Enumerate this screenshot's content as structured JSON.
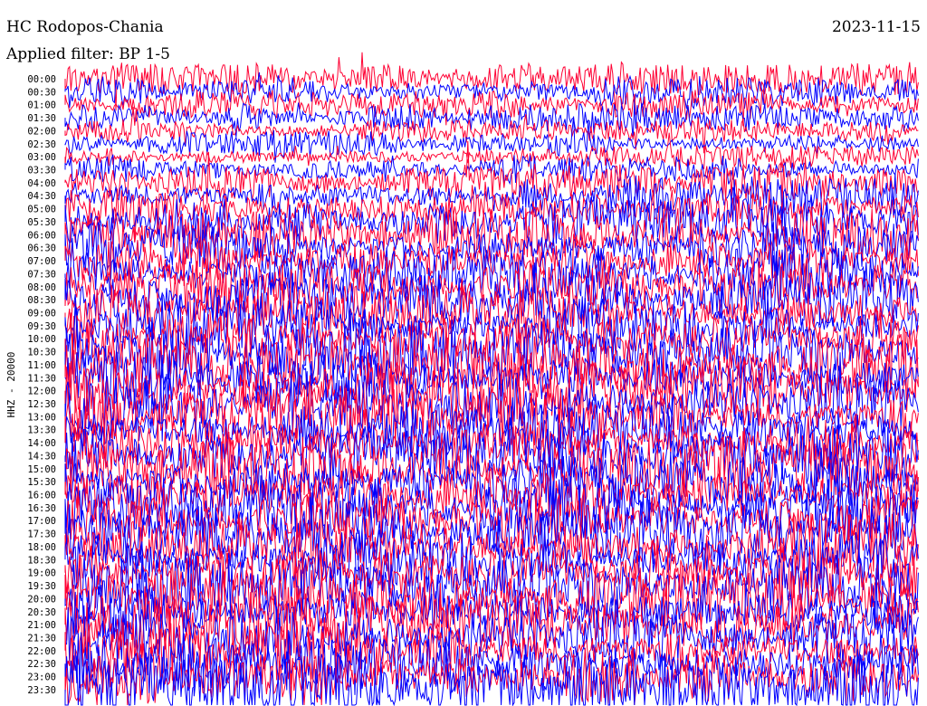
{
  "header": {
    "station": "HC Rodopos-Chania",
    "date": "2023-11-15",
    "filter": "Applied filter: BP 1-5"
  },
  "chart_data": {
    "type": "helicorder",
    "channel_label": "HHZ - 20000",
    "ylabel": "HHZ - 20000",
    "tick_labels": [
      "00:00",
      "00:30",
      "01:00",
      "01:30",
      "02:00",
      "02:30",
      "03:00",
      "03:30",
      "04:00",
      "04:30",
      "05:00",
      "05:30",
      "06:00",
      "06:30",
      "07:00",
      "07:30",
      "08:00",
      "08:30",
      "09:00",
      "09:30",
      "10:00",
      "10:30",
      "11:00",
      "11:30",
      "12:00",
      "12:30",
      "13:00",
      "13:30",
      "14:00",
      "14:30",
      "15:00",
      "15:30",
      "16:00",
      "16:30",
      "17:00",
      "17:30",
      "18:00",
      "18:30",
      "19:00",
      "19:30",
      "20:00",
      "20:30",
      "21:00",
      "21:30",
      "22:00",
      "22:30",
      "23:00",
      "23:30"
    ],
    "trace_colors": [
      "#ff0033",
      "#0000ff"
    ],
    "rows_per_hour": 2,
    "minutes_per_row": 30,
    "relative_amplitude": [
      1.0,
      1.0,
      0.9,
      0.9,
      0.7,
      0.8,
      0.7,
      0.9,
      1.2,
      1.4,
      1.6,
      1.7,
      1.7,
      1.6,
      1.6,
      1.7,
      1.8,
      1.8,
      1.8,
      1.8,
      1.9,
      1.9,
      2.0,
      2.0,
      2.0,
      2.0,
      2.0,
      2.0,
      2.0,
      2.0,
      2.0,
      2.0,
      2.0,
      2.0,
      2.0,
      2.0,
      2.0,
      2.0,
      2.0,
      2.0,
      2.0,
      2.0,
      2.0,
      2.0,
      2.0,
      2.0,
      2.2,
      2.4
    ]
  },
  "colors": {
    "red_trace": "#ff0033",
    "blue_trace": "#0000ff",
    "background": "#ffffff"
  }
}
